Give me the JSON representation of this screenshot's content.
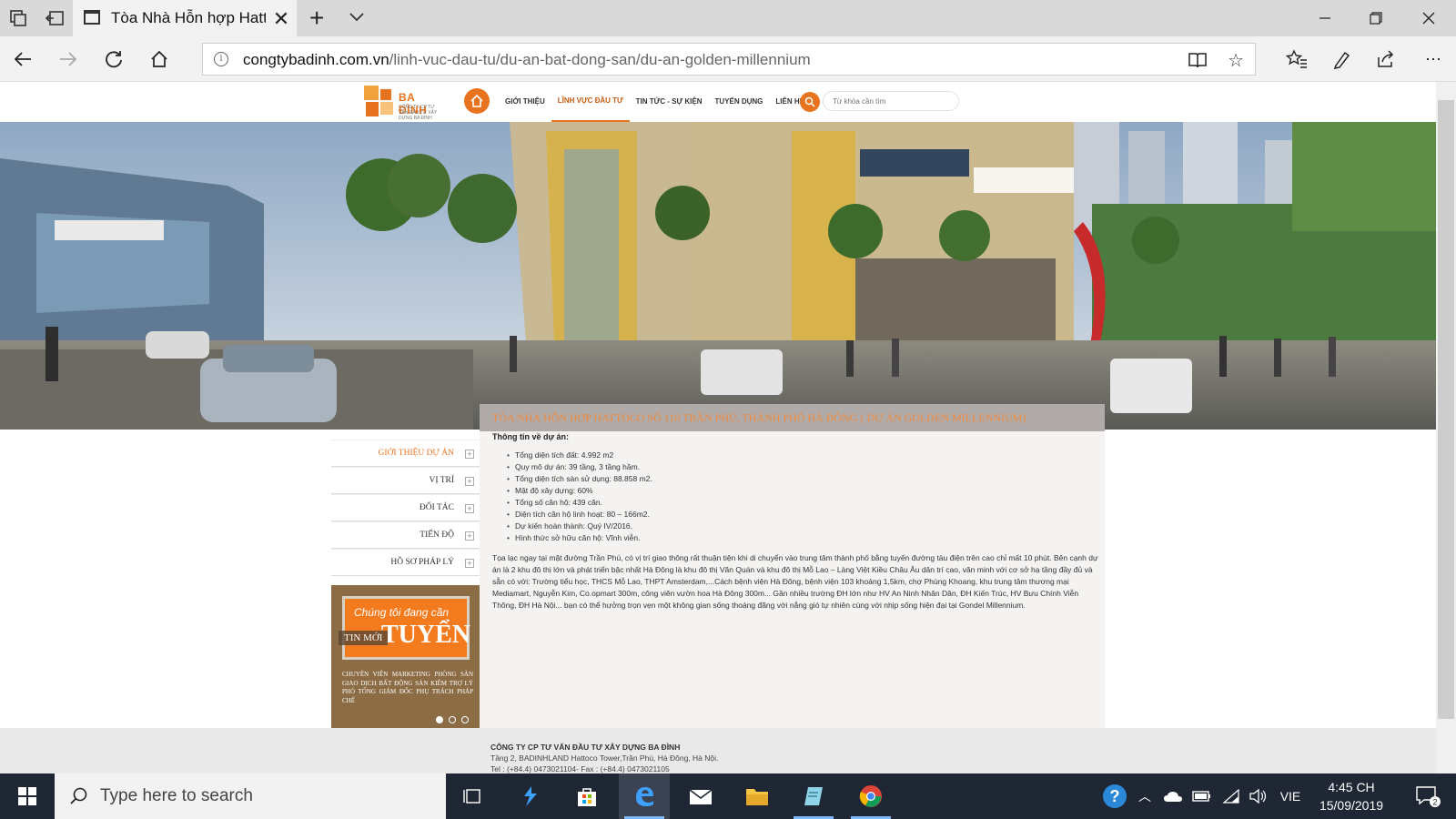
{
  "browser": {
    "tab_title": "Tòa Nhà Hỗn hợp Hattc",
    "url_host": "congtybadinh.com.vn",
    "url_path": "/linh-vuc-dau-tu/du-an-bat-dong-san/du-an-golden-millennium"
  },
  "site": {
    "logo_text": "BA ĐÌNH",
    "logo_sub": "CÔNG TY CP TƯ VẤN ĐẦU TƯ XÂY DỰNG BA ĐÌNH",
    "nav": [
      {
        "label": "GIỚI THIỆU",
        "active": false
      },
      {
        "label": "LĨNH VỰC ĐẦU TƯ",
        "active": true
      },
      {
        "label": "TIN TỨC - SỰ KIỆN",
        "active": false
      },
      {
        "label": "TUYỂN DỤNG",
        "active": false
      },
      {
        "label": "LIÊN HỆ",
        "active": false
      }
    ],
    "search_placeholder": "Từ khóa cần tìm",
    "accent": "#e8731f"
  },
  "project": {
    "title": "TÒA NHÀ HỖN HỢP HATTOCO SỐ 110 TRẦN PHÚ, THÀNH PHỐ HÀ ĐÔNG ( DỰ ÁN GOLDEN MILLENNIUM)",
    "info_heading": "Thông tin về dự án:",
    "facts": [
      "Tổng diện tích đất: 4.992 m2",
      "Quy mô dự án: 39 tầng, 3 tầng hầm.",
      "Tổng diện tích sàn sử dụng: 88.858 m2.",
      "Mật độ xây dựng: 60%",
      "Tổng số căn hộ: 439 căn.",
      "Diện tích căn hộ linh hoạt: 80 – 166m2.",
      "Dự kiến hoàn thành: Quý IV/2016.",
      "Hình thức sở hữu căn hộ: Vĩnh viễn."
    ],
    "description": "Tọa lạc ngay tại mặt đường Trần Phú, có vị trí giao thông rất thuận tiện khi di chuyển vào trung tâm thành phố bằng tuyến đường tàu điện trên cao chỉ mất 10 phút. Bên cạnh dự án là 2 khu đô thị lớn và phát triển bậc nhất Hà Đông là khu đô thị Văn Quán và khu đô thị Mỗ Lao – Làng Việt Kiều Châu Âu dân trí cao, văn minh với cơ sở hạ tầng đầy đủ và sẵn có với: Trường tiểu học, THCS Mỗ Lao, THPT Amsterdam,...Cách bệnh viện Hà Đông, bệnh viện 103 khoảng 1,5km, chợ Phùng Khoang, khu trung tâm thương mại Mediamart, Nguyễn Kim, Co.opmart 300m, công viên vườn hoa Hà Đông 300m... Gần nhiều trường ĐH lớn như HV An Ninh Nhân Dân, ĐH Kiến Trúc, HV Bưu Chính Viễn Thông, ĐH Hà Nội... bạn có thể hưởng trọn vẹn một không gian sống thoáng đãng với nắng gió tự nhiên cùng với nhịp sống hiện đại tại Gondel Millennium."
  },
  "side_menu": [
    {
      "label": "GIỚI THIỆU DỰ ÁN",
      "active": true
    },
    {
      "label": "VỊ TRÍ",
      "active": false
    },
    {
      "label": "ĐỐI TÁC",
      "active": false
    },
    {
      "label": "TIẾN ĐỘ",
      "active": false
    },
    {
      "label": "HỒ SƠ PHÁP LÝ",
      "active": false
    }
  ],
  "news": {
    "label": "TIN MỚI",
    "banner_line1": "Chúng tôi đang cần",
    "banner_line2": "TUYỂN",
    "text": "CHUYÊN VIÊN MARKETING PHÒNG SÀN GIAO DỊCH BẤT ĐỘNG SẢN KIÊM TRỢ LÝ PHÓ TỔNG GIÁM ĐỐC PHỤ TRÁCH PHÁP CHẾ"
  },
  "footer": {
    "company": "CÔNG TY CP TƯ VẤN ĐẦU TƯ XÂY DỰNG BA ĐÌNH",
    "address": "Tầng 2, BADINHLAND Hattoco Tower,Trần Phú, Hà Đông, Hà Nội.",
    "phone": "Tel : (+84.4) 0473021104- Fax : (+84.4) 0473021105"
  },
  "taskbar": {
    "search_placeholder": "Type here to search",
    "language": "VIE",
    "time": "4:45 CH",
    "date": "15/09/2019",
    "notifications": "2"
  }
}
